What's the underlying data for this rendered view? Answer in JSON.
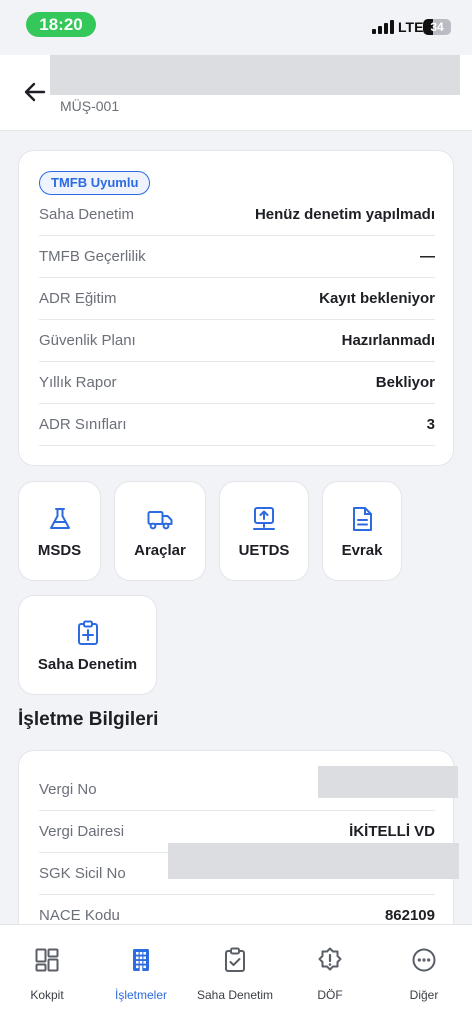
{
  "status_bar": {
    "time": "18:20",
    "network": "LTE",
    "battery": "34",
    "battery_level": 0.34
  },
  "header": {
    "subtitle": "MÜŞ-001"
  },
  "status_card": {
    "badge": "TMFB Uyumlu",
    "rows": [
      {
        "label": "Saha Denetim",
        "value": "Henüz denetim yapılmadı"
      },
      {
        "label": "TMFB Geçerlilik",
        "value": "—"
      },
      {
        "label": "ADR Eğitim",
        "value": "Kayıt bekleniyor"
      },
      {
        "label": "Güvenlik Planı",
        "value": "Hazırlanmadı"
      },
      {
        "label": "Yıllık Rapor",
        "value": "Bekliyor"
      },
      {
        "label": "ADR Sınıfları",
        "value": "3"
      }
    ]
  },
  "quick_actions": [
    {
      "label": "MSDS",
      "icon": "flask-icon"
    },
    {
      "label": "Araçlar",
      "icon": "truck-icon"
    },
    {
      "label": "UETDS",
      "icon": "upload-network-icon"
    },
    {
      "label": "Evrak",
      "icon": "document-icon"
    },
    {
      "label": "Saha Denetim",
      "icon": "clipboard-plus-icon"
    }
  ],
  "business": {
    "title": "İşletme Bilgileri",
    "rows": [
      {
        "label": "Vergi No",
        "value": ""
      },
      {
        "label": "Vergi Dairesi",
        "value": "İKİTELLİ VD"
      },
      {
        "label": "SGK Sicil No",
        "value": ""
      },
      {
        "label": "NACE Kodu",
        "value": "862109"
      }
    ]
  },
  "bottom_nav": [
    {
      "label": "Kokpit",
      "icon": "dashboard-icon"
    },
    {
      "label": "İşletmeler",
      "icon": "building-icon"
    },
    {
      "label": "Saha Denetim",
      "icon": "clipboard-check-icon"
    },
    {
      "label": "DÖF",
      "icon": "alert-gear-icon"
    },
    {
      "label": "Diğer",
      "icon": "more-icon"
    }
  ],
  "colors": {
    "accent": "#2d6be0",
    "time_pill": "#34c759",
    "background": "#f2f3f6"
  }
}
